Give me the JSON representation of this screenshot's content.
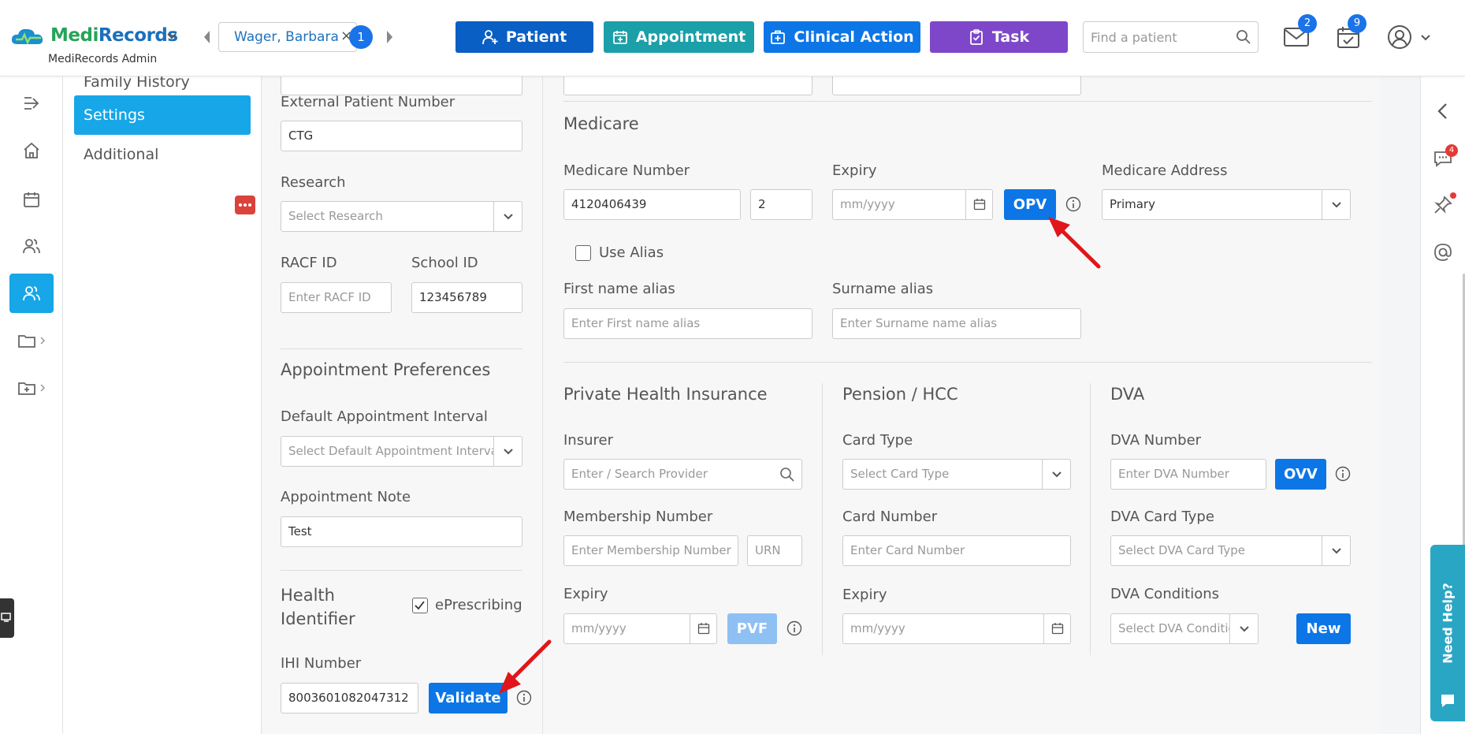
{
  "header": {
    "brand_medi": "Medi",
    "brand_records": "Records",
    "admin_label": "MediRecords Admin",
    "patient_tab": "Wager, Barbara",
    "patient_tab_close": "×",
    "patient_tab_count": "1",
    "btn_patient": "Patient",
    "btn_appointment": "Appointment",
    "btn_clinical_action": "Clinical Action",
    "btn_task": "Task",
    "search_placeholder": "Find a patient",
    "mail_badge": "2",
    "calendar_badge": "9"
  },
  "submenu": {
    "family_history": "Family History",
    "settings": "Settings",
    "additional": "Additional"
  },
  "column1": {
    "external_patient_number_label": "External Patient Number",
    "external_patient_number": "CTG",
    "research_label": "Research",
    "research_placeholder": "Select Research",
    "racf_label": "RACF ID",
    "racf_placeholder": "Enter RACF ID",
    "school_label": "School ID",
    "school_value": "123456789",
    "appt_pref_title": "Appointment Preferences",
    "default_interval_label": "Default Appointment Interval",
    "default_interval_placeholder": "Select Default Appointment Interval",
    "appt_note_label": "Appointment Note",
    "appt_note_value": "Test",
    "health_identifier_line1": "Health",
    "health_identifier_line2": "Identifier",
    "eprescribing_label": "ePrescribing",
    "ihi_label": "IHI Number",
    "ihi_value": "8003601082047312",
    "validate_button": "Validate"
  },
  "medicare": {
    "title": "Medicare",
    "number_label": "Medicare Number",
    "number_value": "4120406439",
    "irn_value": "2",
    "expiry_label": "Expiry",
    "expiry_placeholder": "mm/yyyy",
    "opv_button": "OPV",
    "address_label": "Medicare Address",
    "address_value": "Primary",
    "use_alias_label": "Use Alias",
    "first_alias_label": "First name alias",
    "first_alias_placeholder": "Enter First name alias",
    "surname_alias_label": "Surname alias",
    "surname_alias_placeholder": "Enter Surname name alias"
  },
  "phi": {
    "title": "Private Health Insurance",
    "insurer_label": "Insurer",
    "insurer_placeholder": "Enter / Search Provider",
    "membership_label": "Membership Number",
    "membership_placeholder": "Enter Membership Number",
    "urn_placeholder": "URN",
    "expiry_label": "Expiry",
    "expiry_placeholder": "mm/yyyy",
    "pvf_button": "PVF"
  },
  "pension": {
    "title": "Pension / HCC",
    "card_type_label": "Card Type",
    "card_type_placeholder": "Select Card Type",
    "card_number_label": "Card Number",
    "card_number_placeholder": "Enter Card Number",
    "expiry_label": "Expiry",
    "expiry_placeholder": "mm/yyyy"
  },
  "dva": {
    "title": "DVA",
    "number_label": "DVA Number",
    "number_placeholder": "Enter DVA Number",
    "ovv_button": "OVV",
    "card_type_label": "DVA Card Type",
    "card_type_placeholder": "Select DVA Card Type",
    "conditions_label": "DVA Conditions",
    "conditions_placeholder": "Select DVA Conditions",
    "new_button": "New"
  },
  "right_panel": {
    "chat_badge": "4",
    "help_label": "Need Help?"
  },
  "colors": {
    "patient_btn": "#0a5fc4",
    "appointment_btn": "#1b9fa8",
    "clinical_btn": "#0d76e6",
    "task_btn": "#7e47c9",
    "settings_active": "#17a6e7",
    "arrow": "#e0161b"
  }
}
